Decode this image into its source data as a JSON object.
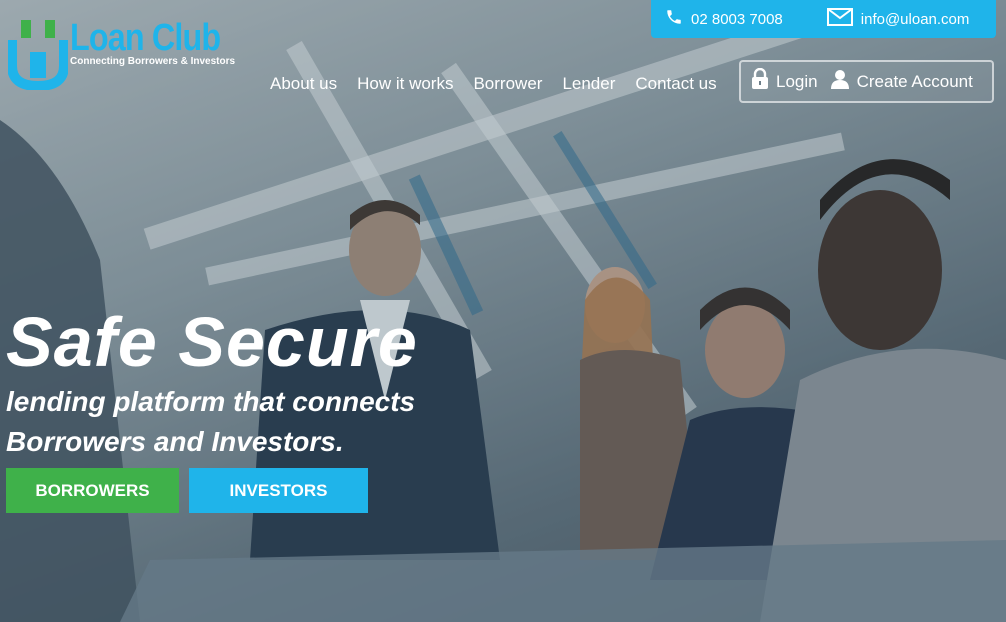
{
  "topbar": {
    "phone": "02 8003 7008",
    "email": "info@uloan.com"
  },
  "logo": {
    "brand": "Loan Club",
    "tagline": "Connecting Borrowers & Investors"
  },
  "nav": {
    "items": [
      "About us",
      "How it works",
      "Borrower",
      "Lender",
      "Contact us"
    ]
  },
  "auth": {
    "login": "Login",
    "create": "Create Account"
  },
  "hero": {
    "headline": "Safe Secure",
    "subline_1": "lending platform that connects",
    "subline_2": "Borrowers and Investors."
  },
  "cta": {
    "borrowers": "BORROWERS",
    "investors": "INVESTORS"
  },
  "colors": {
    "accent_blue": "#1fb4ea",
    "accent_green": "#3fb14a"
  }
}
